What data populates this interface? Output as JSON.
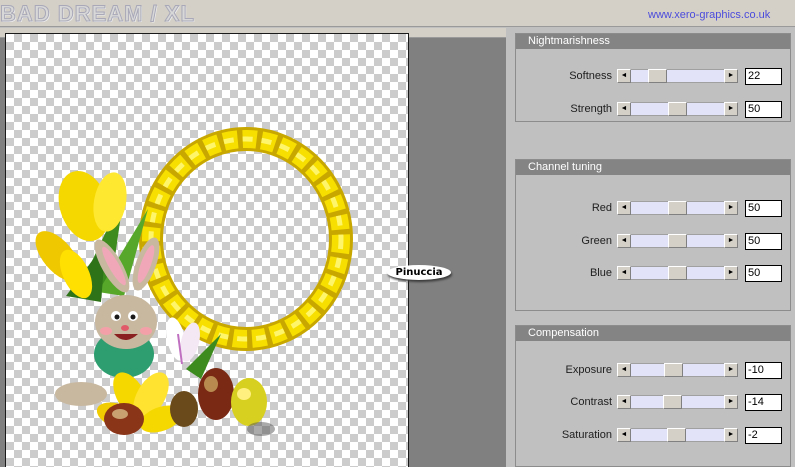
{
  "header": {
    "brand": "BAD DREAM / XL",
    "url": "www.xero-graphics.co.uk"
  },
  "preview": {
    "watermark": "Pinuccia"
  },
  "panels": [
    {
      "title": "Nightmarishness",
      "sliders": [
        {
          "label": "Softness",
          "value": "22",
          "position": 0.22
        },
        {
          "label": "Strength",
          "value": "50",
          "position": 0.5
        }
      ]
    },
    {
      "title": "Channel tuning",
      "sliders": [
        {
          "label": "Red",
          "value": "50",
          "position": 0.5
        },
        {
          "label": "Green",
          "value": "50",
          "position": 0.5
        },
        {
          "label": "Blue",
          "value": "50",
          "position": 0.5
        }
      ]
    },
    {
      "title": "Compensation",
      "sliders": [
        {
          "label": "Exposure",
          "value": "-10",
          "position": 0.45
        },
        {
          "label": "Contrast",
          "value": "-14",
          "position": 0.43
        },
        {
          "label": "Saturation",
          "value": "-2",
          "position": 0.49
        }
      ]
    }
  ],
  "icons": {
    "arrow_left": "◄",
    "arrow_right": "►"
  },
  "colors": {
    "accent_url": "#4b4bdc",
    "panel_header": "#848484",
    "slider_track": "#e2e2f8"
  }
}
